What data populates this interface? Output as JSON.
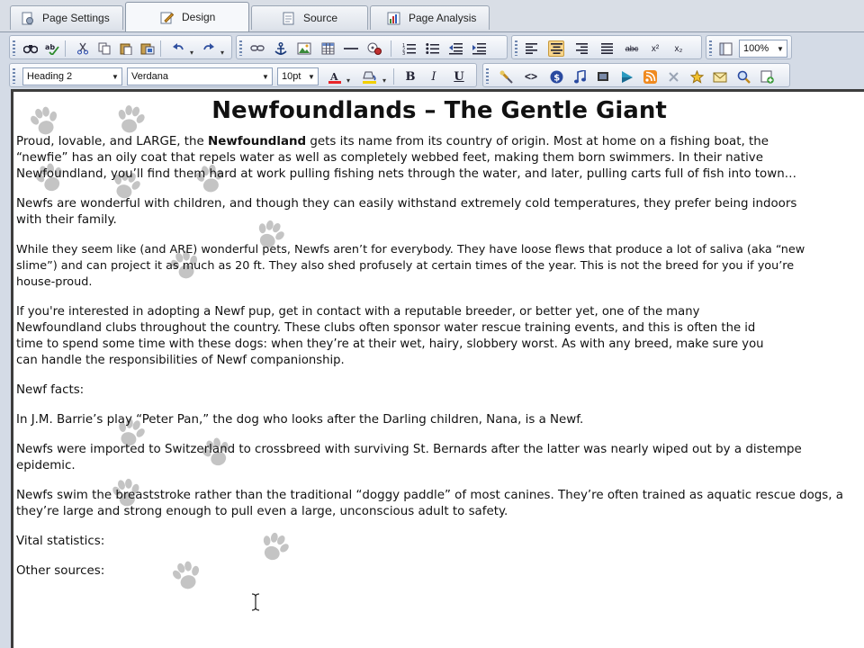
{
  "tabs": [
    {
      "label": "Page Settings",
      "icon": "page-settings-icon",
      "active": false
    },
    {
      "label": "Design",
      "icon": "design-pencil-icon",
      "active": true
    },
    {
      "label": "Source",
      "icon": "source-page-icon",
      "active": false
    },
    {
      "label": "Page Analysis",
      "icon": "chart-icon",
      "active": false
    }
  ],
  "toolbar": {
    "zoom": "100%",
    "style": "Heading 2",
    "font": "Verdana",
    "size": "10pt",
    "bold": "B",
    "italic": "I",
    "underline": "U",
    "strike": "abc",
    "superscript": "x²",
    "subscript": "x₂",
    "source_tag": "<>",
    "colors": {
      "font_color": "#e8252a",
      "highlight": "#f2d000",
      "accent": "#f7d48a"
    }
  },
  "document": {
    "title": "Newfoundlands – The Gentle Giant",
    "p1": {
      "intro": "Proud, lovable, and LARGE, the ",
      "bold": "Newfoundland",
      "rest": " gets its name from its country of origin. Most at home on a fishing boat, the",
      "line2": "“newfie” has an oily coat that repels water as well as completely webbed feet, making them born swimmers. In their native",
      "line3": "Newfoundland, you’ll find them hard at work pulling fishing nets through the water, and later, pulling carts full of fish into town…"
    },
    "p2": {
      "line1": "Newfs are wonderful with children, and though they can easily withstand extremely cold temperatures, they prefer being indoors",
      "line2": "with their family."
    },
    "p3": {
      "line1": "While they seem like (and ARE) wonderful pets, Newfs aren’t for everybody. They have loose flews that produce a lot of saliva (aka “new",
      "line2": "slime”) and can project it as much as 20 ft. They also shed profusely at certain times of the year. This is not the breed for you if you’re",
      "line3": "house-proud."
    },
    "p4": {
      "line1": "If you're interested in adopting a Newf pup, get in contact with a reputable breeder, or better yet, one of the many",
      "line2": "Newfoundland clubs throughout the country. These clubs often sponsor water rescue training events, and this is often the id",
      "line3": "time to spend some time with these dogs: when they’re at their wet, hairy, slobbery worst. As with any breed, make sure you",
      "line4": "can handle the responsibilities of Newf companionship."
    },
    "facts_heading": "Newf facts:",
    "fact1": "In J.M. Barrie’s play “Peter Pan,” the dog who looks after the Darling children, Nana, is a Newf.",
    "fact2": {
      "line1": "Newfs were imported to Switzerland to crossbreed with surviving St. Bernards after the latter was nearly wiped out by a distempe",
      "line2": "epidemic."
    },
    "fact3": {
      "line1": "Newfs swim the breaststroke rather than the traditional “doggy paddle” of most canines. They’re often trained as aquatic rescue dogs, a",
      "line2": "they’re large and strong enough to pull even a large, unconscious adult to safety."
    },
    "vital": "Vital statistics:",
    "other": "Other sources:"
  }
}
